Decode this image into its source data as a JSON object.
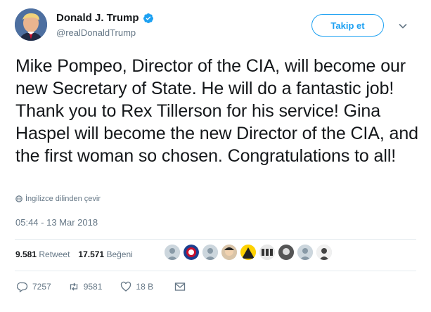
{
  "author": {
    "display_name": "Donald J. Trump",
    "handle": "@realDonaldTrump"
  },
  "follow_label": "Takip et",
  "tweet": {
    "text": "Mike Pompeo, Director of the CIA, will become our new Secretary of State. He will do a fantastic job! Thank you to Rex Tillerson for his service! Gina Haspel will become the new Director of the CIA, and the first woman so chosen. Congratulations to all!",
    "translate_label": "İngilizce dilinden çevir",
    "timestamp": "05:44 - 13 Mar 2018"
  },
  "stats": {
    "retweets_count": "9.581",
    "retweets_label": "Retweet",
    "likes_count": "17.571",
    "likes_label": "Beğeni"
  },
  "actions": {
    "replies": "7257",
    "retweets": "9581",
    "likes": "18 B"
  },
  "colors": {
    "accent": "#1da1f2",
    "secondary_text": "#657786",
    "divider": "#e6ecf0"
  },
  "icons": [
    "verified-badge-icon",
    "chevron-down-icon",
    "globe-icon",
    "reply-icon",
    "retweet-icon",
    "like-icon",
    "message-icon"
  ]
}
